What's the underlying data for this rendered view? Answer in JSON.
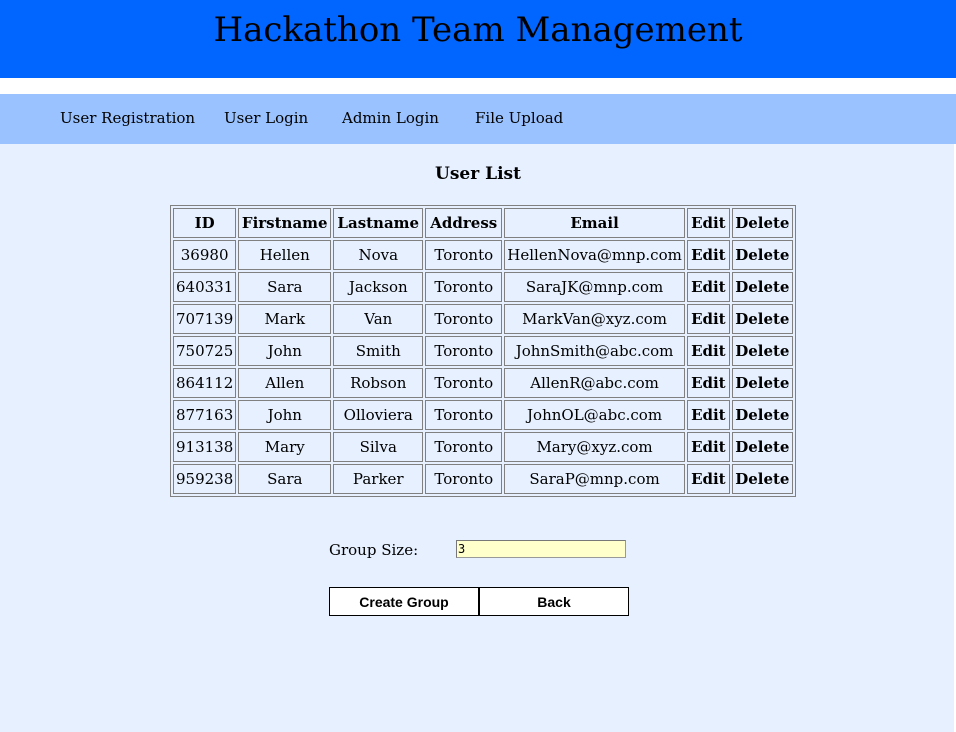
{
  "header": {
    "title": "Hackathon Team Management"
  },
  "nav": {
    "items": [
      {
        "label": "User Registration"
      },
      {
        "label": "User Login"
      },
      {
        "label": "Admin Login"
      },
      {
        "label": "File Upload"
      }
    ]
  },
  "main": {
    "title": "User List",
    "table": {
      "columns": [
        "ID",
        "Firstname",
        "Lastname",
        "Address",
        "Email",
        "Edit",
        "Delete"
      ],
      "rows": [
        {
          "id": "36980",
          "firstname": "Hellen",
          "lastname": "Nova",
          "address": "Toronto",
          "email": "HellenNova@mnp.com",
          "edit": "Edit",
          "delete": "Delete"
        },
        {
          "id": "640331",
          "firstname": "Sara",
          "lastname": "Jackson",
          "address": "Toronto",
          "email": "SaraJK@mnp.com",
          "edit": "Edit",
          "delete": "Delete"
        },
        {
          "id": "707139",
          "firstname": "Mark",
          "lastname": "Van",
          "address": "Toronto",
          "email": "MarkVan@xyz.com",
          "edit": "Edit",
          "delete": "Delete"
        },
        {
          "id": "750725",
          "firstname": "John",
          "lastname": "Smith",
          "address": "Toronto",
          "email": "JohnSmith@abc.com",
          "edit": "Edit",
          "delete": "Delete"
        },
        {
          "id": "864112",
          "firstname": "Allen",
          "lastname": "Robson",
          "address": "Toronto",
          "email": "AllenR@abc.com",
          "edit": "Edit",
          "delete": "Delete"
        },
        {
          "id": "877163",
          "firstname": "John",
          "lastname": "Olloviera",
          "address": "Toronto",
          "email": "JohnOL@abc.com",
          "edit": "Edit",
          "delete": "Delete"
        },
        {
          "id": "913138",
          "firstname": "Mary",
          "lastname": "Silva",
          "address": "Toronto",
          "email": "Mary@xyz.com",
          "edit": "Edit",
          "delete": "Delete"
        },
        {
          "id": "959238",
          "firstname": "Sara",
          "lastname": "Parker",
          "address": "Toronto",
          "email": "SaraP@mnp.com",
          "edit": "Edit",
          "delete": "Delete"
        }
      ]
    },
    "group_size": {
      "label": "Group Size:",
      "value": "3"
    },
    "buttons": {
      "create_group": "Create Group",
      "back": "Back"
    }
  },
  "colors": {
    "header_bg": "#0066ff",
    "nav_bg": "#99c2ff",
    "page_bg": "#e6f0ff",
    "input_bg": "#ffffcc"
  }
}
